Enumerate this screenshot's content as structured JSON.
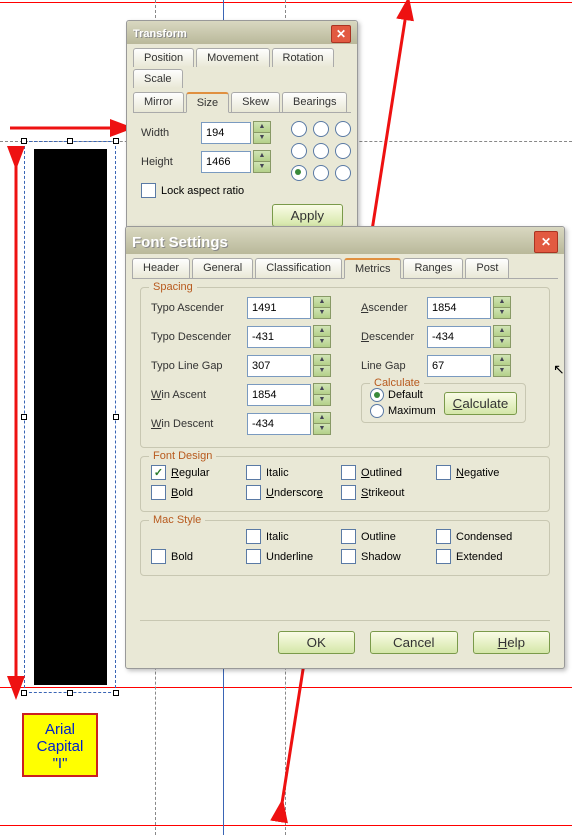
{
  "transform": {
    "title": "Transform",
    "tabs_row1": [
      "Position",
      "Movement",
      "Rotation",
      "Scale"
    ],
    "tabs_row2": [
      "Mirror",
      "Size",
      "Skew",
      "Bearings"
    ],
    "active_tab": "Size",
    "width_label": "Width",
    "width_value": "194",
    "height_label": "Height",
    "height_value": "1466",
    "lock_label": "Lock aspect ratio",
    "lock_checked": false,
    "apply_label": "Apply",
    "origin_selected": 6
  },
  "font": {
    "title": "Font Settings",
    "tabs": [
      "Header",
      "General",
      "Classification",
      "Metrics",
      "Ranges",
      "Post"
    ],
    "active_tab": "Metrics",
    "spacing": {
      "legend": "Spacing",
      "typo_ascender_label": "Typo Ascender",
      "typo_ascender": "1491",
      "typo_descender_label": "Typo Descender",
      "typo_descender": "-431",
      "typo_linegap_label": "Typo Line Gap",
      "typo_linegap": "307",
      "win_ascent_label_pre": "W",
      "win_ascent_label_post": "in Ascent",
      "win_ascent": "1854",
      "win_descent_label_pre": "W",
      "win_descent_label_post": "in Descent",
      "win_descent": "-434",
      "ascender_label": "Ascender",
      "ascender": "1854",
      "descender_label": "Descender",
      "descender": "-434",
      "linegap_label": "Line Gap",
      "linegap": "67"
    },
    "calculate": {
      "legend": "Calculate",
      "default_label": "Default",
      "maximum_label": "Maximum",
      "selected": "default",
      "button": "Calculate"
    },
    "font_design": {
      "legend": "Font Design",
      "regular": "Regular",
      "bold": "Bold",
      "italic": "Italic",
      "underscore": "Underscore",
      "outlined": "Outlined",
      "strikeout": "Strikeout",
      "negative": "Negative",
      "regular_checked": true
    },
    "mac_style": {
      "legend": "Mac Style",
      "bold": "Bold",
      "italic": "Italic",
      "underline": "Underline",
      "outline": "Outline",
      "shadow": "Shadow",
      "condensed": "Condensed",
      "extended": "Extended"
    },
    "ok": "OK",
    "cancel": "Cancel",
    "help": "Help"
  },
  "note": {
    "l1": "Arial",
    "l2": "Capital",
    "l3": "\"I\""
  }
}
